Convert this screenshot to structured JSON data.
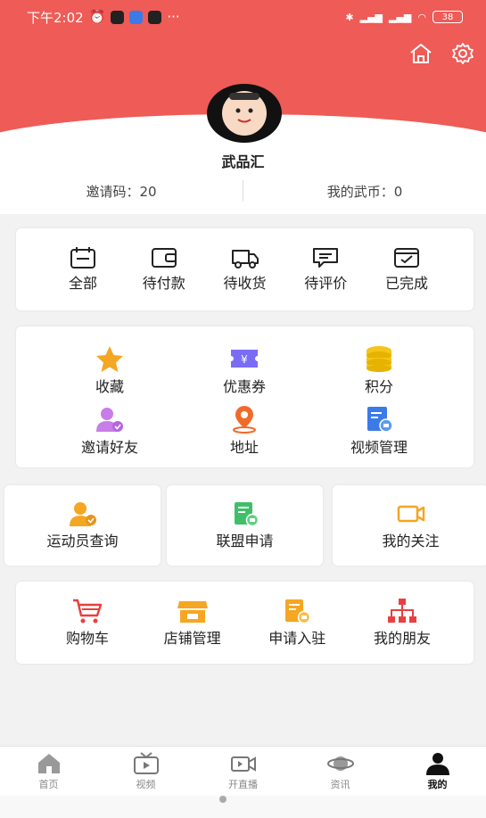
{
  "status_bar": {
    "time": "下午2:02",
    "battery": "38"
  },
  "colors": {
    "brand": "#ef5b56",
    "star": "#f5a623",
    "coupon": "#7b6cf6",
    "points": "#f5c518",
    "friend": "#c77ee8",
    "location": "#f06b2a",
    "video": "#3b7be8",
    "green": "#3fbf6a",
    "cart": "#e84040"
  },
  "header": {
    "home_icon": "home-icon",
    "settings_icon": "gear-icon"
  },
  "profile": {
    "name": "武品汇"
  },
  "stats": {
    "invite_label": "邀请码：20",
    "coins_label": "我的武币：0"
  },
  "orders": [
    {
      "label": "全部",
      "icon": "calendar-icon"
    },
    {
      "label": "待付款",
      "icon": "wallet-icon"
    },
    {
      "label": "待收货",
      "icon": "truck-icon"
    },
    {
      "label": "待评价",
      "icon": "comment-icon"
    },
    {
      "label": "已完成",
      "icon": "check-box-icon"
    }
  ],
  "services": [
    {
      "label": "收藏",
      "icon": "star-icon"
    },
    {
      "label": "优惠券",
      "icon": "coupon-icon"
    },
    {
      "label": "积分",
      "icon": "coins-icon"
    },
    {
      "label": "邀请好友",
      "icon": "add-friend-icon"
    },
    {
      "label": "地址",
      "icon": "location-icon"
    },
    {
      "label": "视频管理",
      "icon": "video-doc-icon"
    }
  ],
  "tiles": [
    {
      "label": "运动员查询",
      "icon": "athlete-icon"
    },
    {
      "label": "联盟申请",
      "icon": "alliance-icon"
    },
    {
      "label": "我的关注",
      "icon": "camera-icon"
    }
  ],
  "tools": [
    {
      "label": "购物车",
      "icon": "cart-icon"
    },
    {
      "label": "店铺管理",
      "icon": "shop-icon"
    },
    {
      "label": "申请入驻",
      "icon": "apply-icon"
    },
    {
      "label": "我的朋友",
      "icon": "network-icon"
    }
  ],
  "nav": [
    {
      "label": "首页",
      "icon": "home-icon"
    },
    {
      "label": "视频",
      "icon": "tv-icon"
    },
    {
      "label": "开直播",
      "icon": "live-camera-icon"
    },
    {
      "label": "资讯",
      "icon": "planet-icon"
    },
    {
      "label": "我的",
      "icon": "person-icon"
    }
  ]
}
